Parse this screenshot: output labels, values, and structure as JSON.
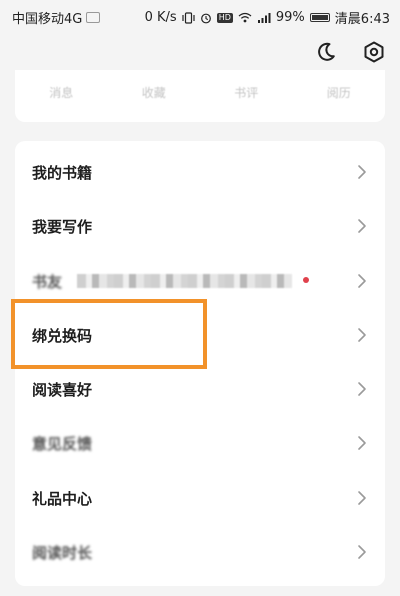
{
  "status_bar": {
    "carrier": "中国移动4G",
    "net_speed": "0 K/s",
    "battery_percent": "99%",
    "battery_level": 0.99,
    "time": "清晨6:43",
    "signal_label": "4G"
  },
  "top_bar": {
    "icons": [
      "moon-icon",
      "settings-hexagon-icon"
    ]
  },
  "stats": {
    "items": [
      {
        "label": "消息"
      },
      {
        "label": "收藏"
      },
      {
        "label": "书评"
      },
      {
        "label": "阅历"
      }
    ]
  },
  "menu": {
    "items": [
      {
        "label": "我的书籍"
      },
      {
        "label": "我要写作"
      },
      {
        "label": "书友"
      },
      {
        "label": "绑兑换码"
      },
      {
        "label": "阅读喜好"
      },
      {
        "label": "意见反馈"
      },
      {
        "label": "礼品中心"
      },
      {
        "label": "阅读时长"
      }
    ]
  },
  "colors": {
    "highlight": "#f2922a",
    "background": "#f4f4f4",
    "card": "#ffffff",
    "text": "#1e1e1e",
    "chevron": "#9a9a9a",
    "badge_dot": "#e0414c"
  }
}
